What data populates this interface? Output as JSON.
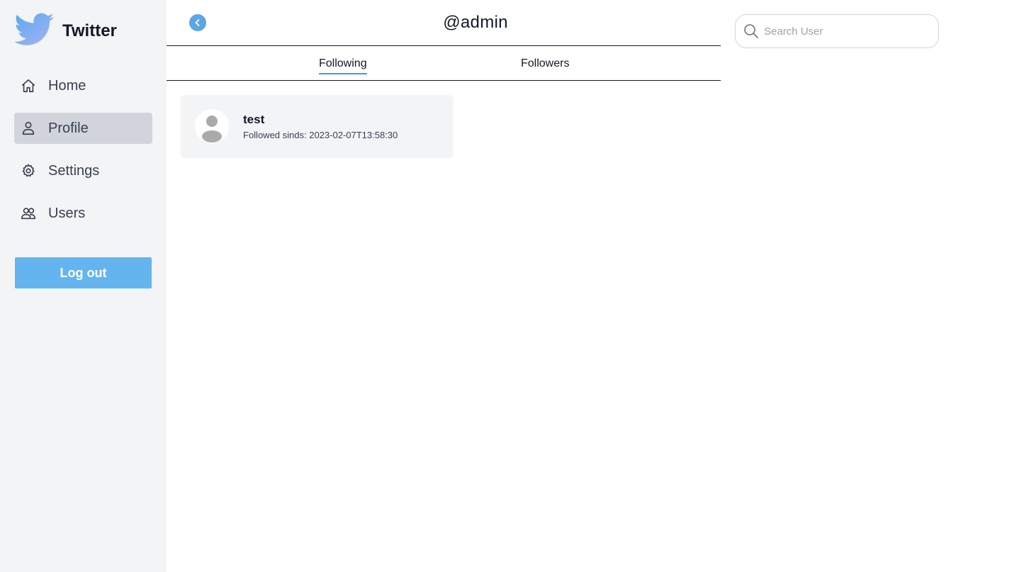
{
  "brand": {
    "name": "Twitter",
    "logo_icon": "twitter-bird-icon",
    "accent": "#64b5ef"
  },
  "sidebar": {
    "items": [
      {
        "label": "Home",
        "icon": "home-icon",
        "active": false
      },
      {
        "label": "Profile",
        "icon": "user-icon",
        "active": true
      },
      {
        "label": "Settings",
        "icon": "gear-icon",
        "active": false
      },
      {
        "label": "Users",
        "icon": "users-icon",
        "active": false
      }
    ],
    "logout_label": "Log out"
  },
  "header": {
    "title": "@admin",
    "back_icon": "chevron-left-icon"
  },
  "tabs": [
    {
      "label": "Following",
      "active": true
    },
    {
      "label": "Followers",
      "active": false
    }
  ],
  "following": [
    {
      "name": "test",
      "meta": "Followed sinds: 2023-02-07T13:58:30",
      "avatar": "default-avatar-icon"
    }
  ],
  "search": {
    "placeholder": "Search User",
    "value": ""
  }
}
